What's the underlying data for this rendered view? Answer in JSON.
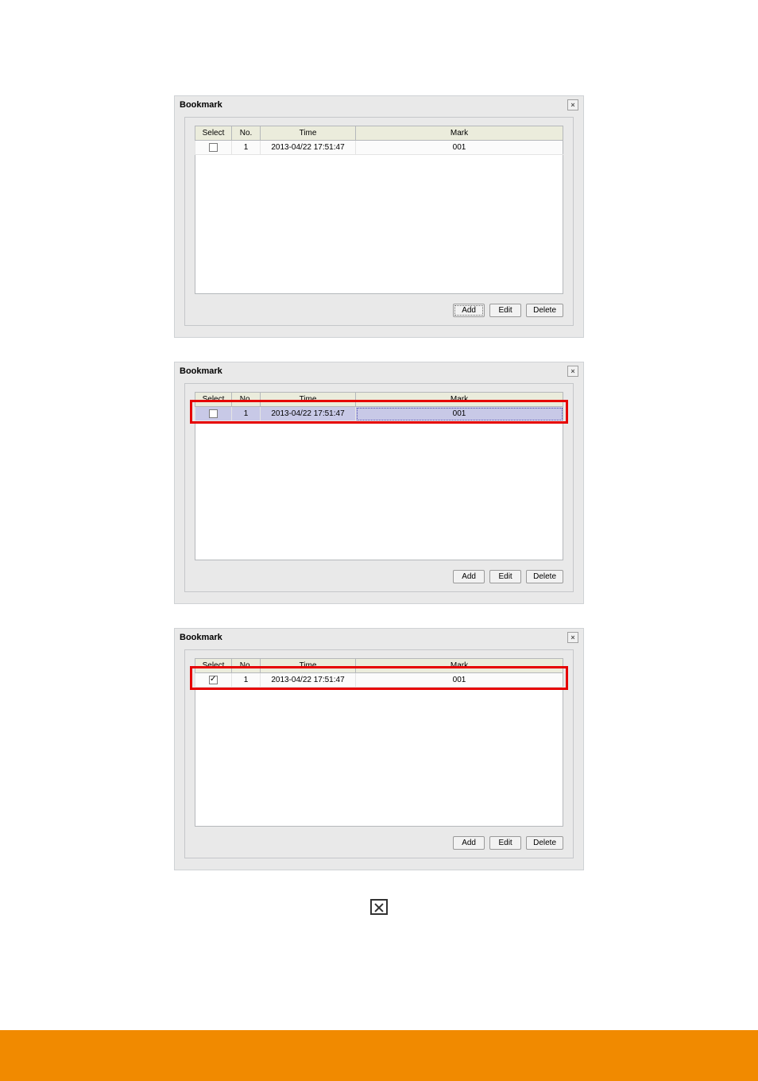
{
  "dialog": {
    "title": "Bookmark",
    "close_label": "×",
    "columns": {
      "select": "Select",
      "no": "No.",
      "time": "Time",
      "mark": "Mark"
    },
    "buttons": {
      "add": "Add",
      "edit": "Edit",
      "delete": "Delete"
    }
  },
  "screens": [
    {
      "rows": [
        {
          "checked": false,
          "no": "1",
          "time": "2013-04/22  17:51:47",
          "mark": "001",
          "selected": false
        }
      ],
      "highlight_row": false,
      "add_focused": true
    },
    {
      "rows": [
        {
          "checked": false,
          "no": "1",
          "time": "2013-04/22  17:51:47",
          "mark": "001",
          "selected": true
        }
      ],
      "highlight_row": true,
      "add_focused": false
    },
    {
      "rows": [
        {
          "checked": true,
          "no": "1",
          "time": "2013-04/22  17:51:47",
          "mark": "001",
          "selected": false
        }
      ],
      "highlight_row": true,
      "add_focused": false
    }
  ]
}
